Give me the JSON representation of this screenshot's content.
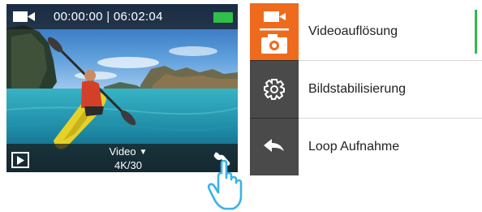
{
  "camera_screen": {
    "timer": "00:00:00 | 06:02:04",
    "mode": "Video",
    "resolution": "4K/30",
    "icons": {
      "record_mode": "video-camera-icon",
      "battery": "battery-full-icon",
      "playback": "play-icon",
      "settings": "wrench-icon",
      "pointer": "tap-hand-icon"
    }
  },
  "settings_menu": {
    "items": [
      {
        "label": "Videoauflösung",
        "icon": "video-photo-icon",
        "active": true
      },
      {
        "label": "Bildstabilisierung",
        "icon": "gear-icon",
        "active": false
      },
      {
        "label": "Loop Aufnahme",
        "icon": "back-arrow-icon",
        "active": false
      }
    ]
  },
  "colors": {
    "accent_orange": "#ee6a1d",
    "battery_green": "#2fbf4a",
    "indicator_green": "#39b54a",
    "icon_column": "#4a4a4a"
  }
}
